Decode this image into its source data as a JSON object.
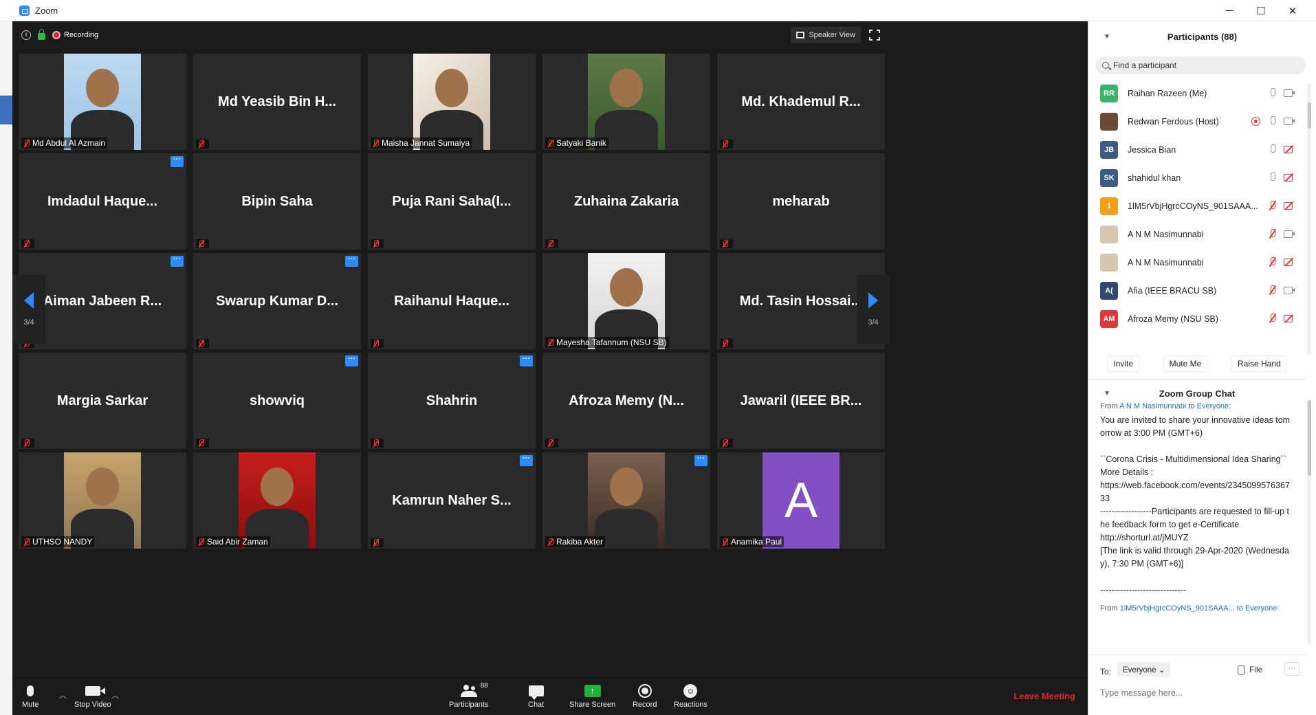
{
  "window": {
    "title": "Zoom",
    "minimize": "─",
    "maximize": "☐",
    "close": "✕"
  },
  "topbar": {
    "recording_label": "Recording",
    "speaker_view_label": "Speaker View"
  },
  "tiles": [
    {
      "name": "",
      "caption": "Md Abdul Al Azmain",
      "photo": "bg-blue",
      "more": false
    },
    {
      "name": "Md Yeasib Bin H...",
      "caption": "",
      "photo": "",
      "more": false
    },
    {
      "name": "",
      "caption": "Maisha Jannat Sumaiya",
      "photo": "bg-bright",
      "more": false
    },
    {
      "name": "",
      "caption": "Satyaki Banik",
      "photo": "bg-green",
      "more": false
    },
    {
      "name": "Md. Khademul R...",
      "caption": "",
      "photo": "",
      "more": false
    },
    {
      "name": "Imdadul Haque...",
      "caption": "",
      "photo": "",
      "more": true
    },
    {
      "name": "Bipin Saha",
      "caption": "",
      "photo": "",
      "more": false
    },
    {
      "name": "Puja Rani Saha(I...",
      "caption": "",
      "photo": "",
      "more": false
    },
    {
      "name": "Zuhaina Zakaria",
      "caption": "",
      "photo": "",
      "more": false
    },
    {
      "name": "meharab",
      "caption": "",
      "photo": "",
      "more": false
    },
    {
      "name": "Aiman Jabeen R...",
      "caption": "",
      "photo": "",
      "more": true
    },
    {
      "name": "Swarup Kumar D...",
      "caption": "",
      "photo": "",
      "more": true
    },
    {
      "name": "Raihanul Haque...",
      "caption": "",
      "photo": "",
      "more": false
    },
    {
      "name": "",
      "caption": "Mayesha Tafannum (NSU SB)",
      "photo": "bg-white",
      "more": false
    },
    {
      "name": "Md. Tasin Hossai...",
      "caption": "",
      "photo": "",
      "more": false
    },
    {
      "name": "Margia Sarkar",
      "caption": "",
      "photo": "",
      "more": false
    },
    {
      "name": "showviq",
      "caption": "",
      "photo": "",
      "more": true
    },
    {
      "name": "Shahrin",
      "caption": "",
      "photo": "",
      "more": true
    },
    {
      "name": "Afroza Memy (N...",
      "caption": "",
      "photo": "",
      "more": false
    },
    {
      "name": "Jawaril (IEEE BR...",
      "caption": "",
      "photo": "",
      "more": false
    },
    {
      "name": "",
      "caption": "UTHSO NANDY",
      "photo": "bg-tan",
      "more": false
    },
    {
      "name": "",
      "caption": "Said Abir Zaman",
      "photo": "bg-red",
      "more": false
    },
    {
      "name": "Kamrun Naher S...",
      "caption": "",
      "photo": "",
      "more": true
    },
    {
      "name": "",
      "caption": "Rakiba Akter",
      "photo": "bg-dark",
      "more": true
    },
    {
      "name": "",
      "caption": "Anamika Paul",
      "photo": "bg-purple",
      "letter": "A",
      "more": false
    }
  ],
  "pager": {
    "left": "3/4",
    "right": "3/4"
  },
  "toolbar": {
    "mute": "Mute",
    "stop_video": "Stop Video",
    "participants": "Participants",
    "participants_count": "88",
    "chat": "Chat",
    "share_screen": "Share Screen",
    "record": "Record",
    "reactions": "Reactions",
    "leave": "Leave Meeting"
  },
  "participants_panel": {
    "title": "Participants (88)",
    "search_placeholder": "Find a participant",
    "list": [
      {
        "initials": "RR",
        "color": "#3bb36b",
        "name": "Raihan Razeen (Me)",
        "mic": "on",
        "cam": "on",
        "rec": false,
        "photo": false
      },
      {
        "initials": "",
        "color": "#6b4a3a",
        "name": "Redwan Ferdous (Host)",
        "mic": "on",
        "cam": "on",
        "rec": true,
        "photo": true
      },
      {
        "initials": "JB",
        "color": "#3d5a80",
        "name": "Jessica Bian",
        "mic": "on",
        "cam": "off",
        "rec": false,
        "photo": false
      },
      {
        "initials": "SK",
        "color": "#3d5a80",
        "name": "shahidul khan",
        "mic": "on",
        "cam": "off",
        "rec": false,
        "photo": false
      },
      {
        "initials": "1",
        "color": "#f2a11d",
        "name": "1lM5rVbjHgrcCOyNS_901SAAA...",
        "mic": "off",
        "cam": "off",
        "rec": false,
        "photo": false
      },
      {
        "initials": "",
        "color": "#d8c6b0",
        "name": "A N M Nasimunnabi",
        "mic": "off",
        "cam": "on",
        "rec": false,
        "photo": true
      },
      {
        "initials": "",
        "color": "#d8c6b0",
        "name": "A N M Nasimunnabi",
        "mic": "off",
        "cam": "off",
        "rec": false,
        "photo": true
      },
      {
        "initials": "A(",
        "color": "#2f4a6e",
        "name": "Afia (IEEE BRACU SB)",
        "mic": "off",
        "cam": "on",
        "rec": false,
        "photo": false
      },
      {
        "initials": "AM",
        "color": "#d93a3a",
        "name": "Afroza Memy (NSU SB)",
        "mic": "off",
        "cam": "off",
        "rec": false,
        "photo": false
      }
    ],
    "actions": [
      "Invite",
      "Mute Me",
      "Raise Hand"
    ]
  },
  "chat": {
    "title": "Zoom Group Chat",
    "from_prefix": "From",
    "to_word": "to",
    "sender": "A N M Nasimunnabi",
    "recipient": "Everyone:",
    "message": "You are invited to share your innovative ideas tomorrow at 3:00 PM (GMT+6)\n\n``Corona Crisis - Multidimensional Idea Sharing``\nMore Details :\nhttps://web.facebook.com/events/234509957636733\n------------------Participants are requested to fill-up the feedback form to get e-Certificate\nhttp://shorturl.at/jMUYZ\n[The link is valid through 29-Apr-2020 (Wednesday), 7:30 PM (GMT+6)]\n\n------------------------------",
    "next_sender": "1lM5rVbjHgrcCOyNS_901SAAA...",
    "next_recipient": "to Everyone:",
    "to_label": "To:",
    "to_value": "Everyone",
    "file_label": "File",
    "more_label": "···",
    "input_placeholder": "Type message here..."
  },
  "colors": {
    "accent": "#2d8cff",
    "danger": "#e02828",
    "share_green": "#21b23c"
  }
}
